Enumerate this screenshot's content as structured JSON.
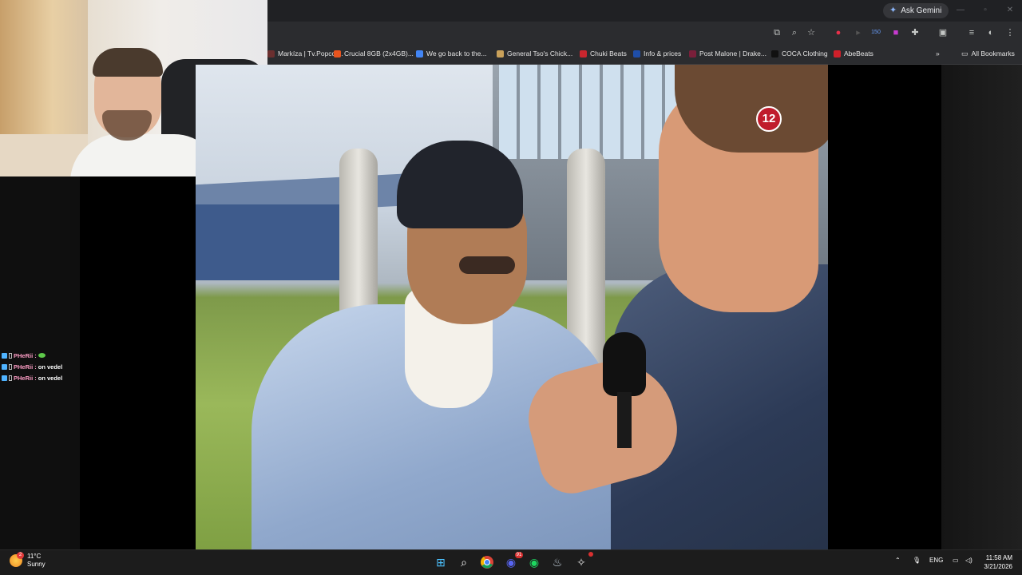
{
  "browser": {
    "ask_gemini_label": "Ask Gemini",
    "bookmarks": [
      {
        "label": "Markíza | Tv.Popcor...",
        "color": "#6b2f2f"
      },
      {
        "label": "Crucial 8GB (2x4GB)...",
        "color": "#e8541e"
      },
      {
        "label": "We go back to the...",
        "color": "#4285f4"
      },
      {
        "label": "General Tso's Chick...",
        "color": "#c9a15a"
      },
      {
        "label": "Chuki Beats",
        "color": "#c8262e"
      },
      {
        "label": "Info & prices",
        "color": "#1f4ea8"
      },
      {
        "label": "Post Malone | Drake...",
        "color": "#7a1f3a"
      },
      {
        "label": "COCA Clothing",
        "color": "#111111"
      },
      {
        "label": "AbeBeats",
        "color": "#d0202a"
      }
    ],
    "more_bookmarks": "»",
    "all_bookmarks_label": "All Bookmarks",
    "extension_badge": "150"
  },
  "chat": {
    "messages": [
      {
        "user": "PHeRii :",
        "text": ""
      },
      {
        "user": "PHeRii :",
        "text": "on vedel"
      },
      {
        "user": "PHeRii :",
        "text": "on vedel"
      }
    ]
  },
  "video": {
    "channel_logo": "12"
  },
  "taskbar": {
    "weather_temp": "11°C",
    "weather_desc": "Sunny",
    "weather_badge": "2",
    "discord_badge": "91",
    "lang": "ENG",
    "time": "11:58 AM",
    "date": "3/21/2026"
  }
}
